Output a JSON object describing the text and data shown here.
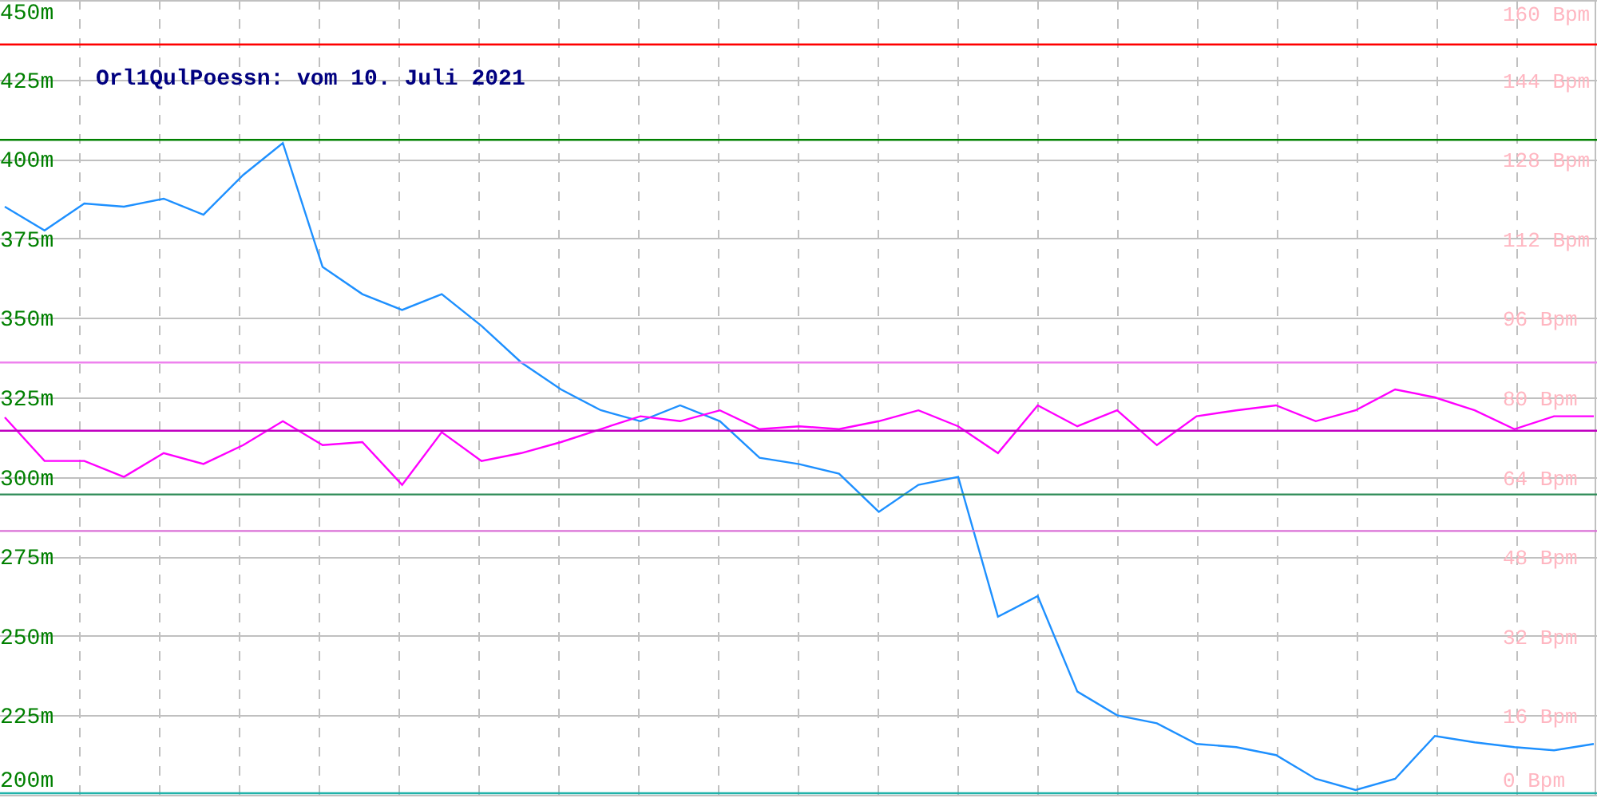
{
  "chart_data": {
    "type": "line",
    "title": "Orl1QulPoessn: vom 10. Juli 2021",
    "ylim": [
      200,
      450
    ],
    "yticks": [
      {
        "value": 200,
        "label": "200m"
      },
      {
        "value": 225,
        "label": "225m"
      },
      {
        "value": 250,
        "label": "250m"
      },
      {
        "value": 275,
        "label": "275m"
      },
      {
        "value": 300,
        "label": "300m"
      },
      {
        "value": 325,
        "label": "325m"
      },
      {
        "value": 350,
        "label": "350m"
      },
      {
        "value": 375,
        "label": "375m"
      },
      {
        "value": 400,
        "label": "400m"
      },
      {
        "value": 425,
        "label": "425m"
      },
      {
        "value": 450,
        "label": "450m"
      }
    ],
    "y2lim": [
      0,
      160
    ],
    "y2ticks": [
      {
        "value": 0,
        "label": "0 Bpm"
      },
      {
        "value": 16,
        "label": "16 Bpm"
      },
      {
        "value": 32,
        "label": "32 Bpm"
      },
      {
        "value": 48,
        "label": "48 Bpm"
      },
      {
        "value": 64,
        "label": "64 Bpm"
      },
      {
        "value": 80,
        "label": "80 Bpm"
      },
      {
        "value": 96,
        "label": "96 Bpm"
      },
      {
        "value": 112,
        "label": "112 Bpm"
      },
      {
        "value": 128,
        "label": "128 Bpm"
      },
      {
        "value": 144,
        "label": "144 Bpm"
      },
      {
        "value": 160,
        "label": "160 Bpm"
      }
    ],
    "series": [
      {
        "color": "#1e90ff",
        "values": [
          385,
          377.5,
          386,
          385,
          387.5,
          382.5,
          395,
          405,
          366,
          357.5,
          352.5,
          357.5,
          347.5,
          336,
          327.5,
          321,
          317.5,
          322.5,
          317.5,
          306,
          304,
          301,
          289,
          297.5,
          300,
          256,
          262.5,
          232.5,
          225,
          222.5,
          216,
          215,
          212.5,
          205,
          201.5,
          205,
          218.5,
          216.5,
          215,
          214,
          216
        ]
      },
      {
        "color": "#ff00ff",
        "axis": "y2",
        "values": [
          76,
          67.2,
          67.2,
          64,
          68.8,
          66.6,
          70.4,
          75.2,
          70.4,
          71,
          62.4,
          73,
          67.2,
          68.8,
          71,
          73.6,
          76.2,
          75.2,
          77.4,
          73.6,
          74.2,
          73.6,
          75.2,
          77.4,
          74.2,
          68.8,
          78.4,
          74.2,
          77.4,
          70.4,
          76.2,
          77.4,
          78.4,
          75.2,
          77.4,
          81.6,
          80,
          77.4,
          73.6,
          76.2,
          76.2
        ]
      },
      {
        "color": "#ff0000",
        "values": [
          436,
          436,
          436,
          436,
          436,
          436,
          436,
          436,
          436,
          436,
          436,
          436,
          436,
          436,
          436,
          436,
          436,
          436,
          436,
          436,
          436,
          436,
          436,
          436,
          436,
          436,
          436,
          436,
          436,
          436,
          436,
          436,
          436,
          436,
          436,
          436,
          436,
          436,
          436,
          436,
          436
        ]
      },
      {
        "color": "#008000",
        "values": [
          406,
          406,
          406,
          406,
          406,
          406,
          406,
          406,
          406,
          406,
          406,
          406,
          406,
          406,
          406,
          406,
          406,
          406,
          406,
          406,
          406,
          406,
          406,
          406,
          406,
          406,
          406,
          406,
          406,
          406,
          406,
          406,
          406,
          406,
          406,
          406,
          406,
          406,
          406,
          406,
          406
        ]
      },
      {
        "color": "#ee82ee",
        "values": [
          336,
          336,
          336,
          336,
          336,
          336,
          336,
          336,
          336,
          336,
          336,
          336,
          336,
          336,
          336,
          336,
          336,
          336,
          336,
          336,
          336,
          336,
          336,
          336,
          336,
          336,
          336,
          336,
          336,
          336,
          336,
          336,
          336,
          336,
          336,
          336,
          336,
          336,
          336,
          336,
          336
        ]
      },
      {
        "color": "#c000c0",
        "values": [
          314.5,
          314.5,
          314.5,
          314.5,
          314.5,
          314.5,
          314.5,
          314.5,
          314.5,
          314.5,
          314.5,
          314.5,
          314.5,
          314.5,
          314.5,
          314.5,
          314.5,
          314.5,
          314.5,
          314.5,
          314.5,
          314.5,
          314.5,
          314.5,
          314.5,
          314.5,
          314.5,
          314.5,
          314.5,
          314.5,
          314.5,
          314.5,
          314.5,
          314.5,
          314.5,
          314.5,
          314.5,
          314.5,
          314.5,
          314.5,
          314.5
        ]
      },
      {
        "color": "#2e8b57",
        "values": [
          294.5,
          294.5,
          294.5,
          294.5,
          294.5,
          294.5,
          294.5,
          294.5,
          294.5,
          294.5,
          294.5,
          294.5,
          294.5,
          294.5,
          294.5,
          294.5,
          294.5,
          294.5,
          294.5,
          294.5,
          294.5,
          294.5,
          294.5,
          294.5,
          294.5,
          294.5,
          294.5,
          294.5,
          294.5,
          294.5,
          294.5,
          294.5,
          294.5,
          294.5,
          294.5,
          294.5,
          294.5,
          294.5,
          294.5,
          294.5,
          294.5
        ]
      },
      {
        "color": "#da70d6",
        "values": [
          283,
          283,
          283,
          283,
          283,
          283,
          283,
          283,
          283,
          283,
          283,
          283,
          283,
          283,
          283,
          283,
          283,
          283,
          283,
          283,
          283,
          283,
          283,
          283,
          283,
          283,
          283,
          283,
          283,
          283,
          283,
          283,
          283,
          283,
          283,
          283,
          283,
          283,
          283,
          283,
          283
        ]
      },
      {
        "color": "#20b2aa",
        "values": [
          200.5,
          200.5,
          200.5,
          200.5,
          200.5,
          200.5,
          200.5,
          200.5,
          200.5,
          200.5,
          200.5,
          200.5,
          200.5,
          200.5,
          200.5,
          200.5,
          200.5,
          200.5,
          200.5,
          200.5,
          200.5,
          200.5,
          200.5,
          200.5,
          200.5,
          200.5,
          200.5,
          200.5,
          200.5,
          200.5,
          200.5,
          200.5,
          200.5,
          200.5,
          200.5,
          200.5,
          200.5,
          200.5,
          200.5,
          200.5,
          200.5
        ]
      }
    ],
    "grid": true
  }
}
